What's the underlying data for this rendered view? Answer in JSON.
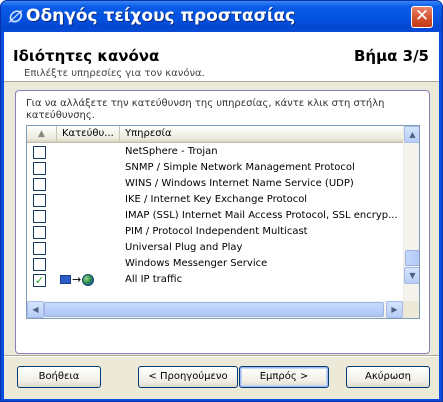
{
  "window": {
    "title": "Οδηγός τείχους προστασίας",
    "icon": "wizard-icon",
    "close_label": "✕"
  },
  "header": {
    "title": "Ιδιότητες κανόνα",
    "step": "Βήμα 3/5",
    "subtitle": "Επιλέξτε υπηρεσίες για τον κανόνα."
  },
  "group": {
    "instructions": "Για να αλλάξετε την κατεύθυνση της υπηρεσίας, κάντε κλικ στη στήλη κατεύθυνσης."
  },
  "list": {
    "columns": {
      "check": "",
      "direction": "Κατεύθυ...",
      "service": "Υπηρεσία"
    },
    "rows": [
      {
        "checked": false,
        "direction": "",
        "service": "NetSphere - Trojan"
      },
      {
        "checked": false,
        "direction": "",
        "service": "SNMP / Simple Network Management Protocol"
      },
      {
        "checked": false,
        "direction": "",
        "service": "WINS / Windows Internet Name Service (UDP)"
      },
      {
        "checked": false,
        "direction": "",
        "service": "IKE / Internet Key Exchange Protocol"
      },
      {
        "checked": false,
        "direction": "",
        "service": "IMAP (SSL) Internet Mail Access Protocol, SSL encryp..."
      },
      {
        "checked": false,
        "direction": "",
        "service": "PIM / Protocol Independent Multicast"
      },
      {
        "checked": false,
        "direction": "",
        "service": "Universal Plug and Play"
      },
      {
        "checked": false,
        "direction": "",
        "service": "Windows Messenger Service"
      },
      {
        "checked": true,
        "direction": "computer-to-internet",
        "service": "All IP traffic"
      }
    ],
    "check_mark": "✓",
    "direction_arrow": "→"
  },
  "buttons": {
    "help": "Βοήθεια",
    "back": "< Προηγούμενο",
    "next": "Εμπρός >",
    "cancel": "Ακύρωση"
  },
  "colors": {
    "titlebar": "#0452e0",
    "close": "#d34e2a",
    "client": "#ece9d8",
    "group_border": "#8a80b8"
  }
}
